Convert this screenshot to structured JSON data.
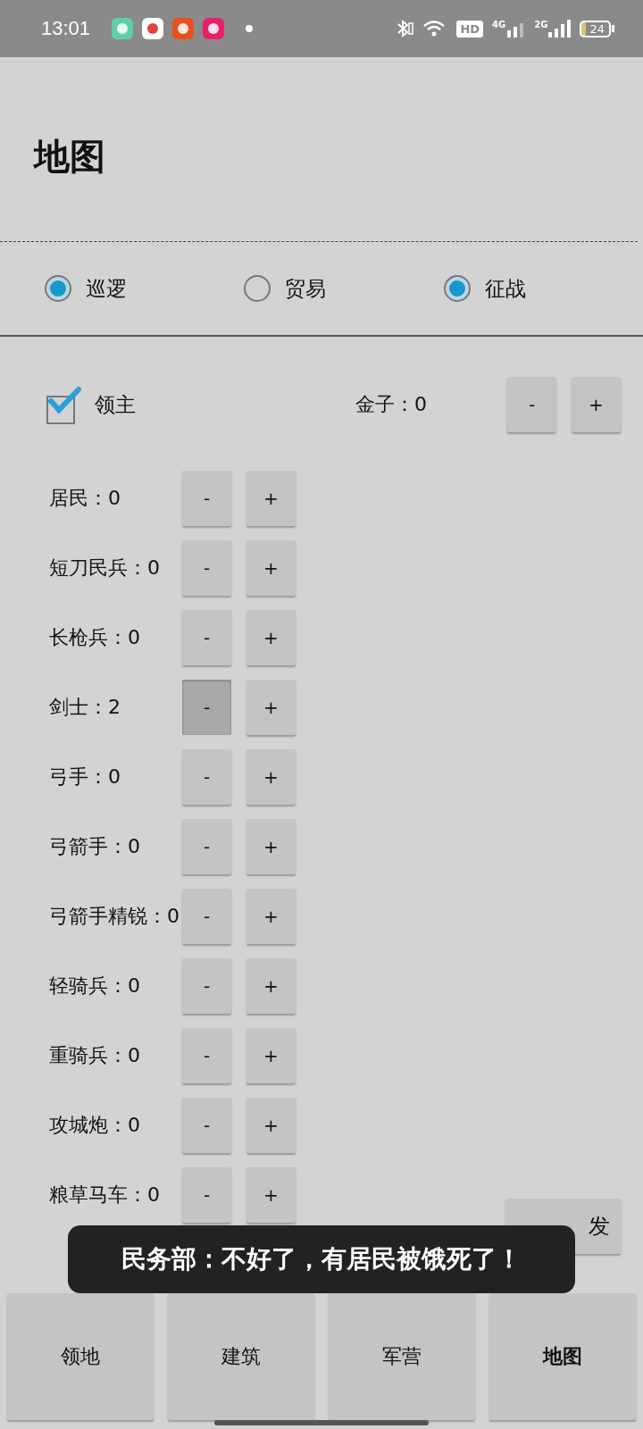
{
  "status_bar": {
    "time": "13:01",
    "hd_label": "HD",
    "network_4g": "4G",
    "network_2g": "2G",
    "battery": "24"
  },
  "title": "地图",
  "modes": [
    {
      "label": "巡逻",
      "checked": true
    },
    {
      "label": "贸易",
      "checked": false
    },
    {
      "label": "征战",
      "checked": true
    }
  ],
  "lord": {
    "label": "领主",
    "checked": true
  },
  "gold": {
    "label": "金子：0",
    "minus": "-",
    "plus": "+"
  },
  "units": [
    {
      "label": "居民：0",
      "minus": "-",
      "plus": "+",
      "minus_pressed": false
    },
    {
      "label": "短刀民兵：0",
      "minus": "-",
      "plus": "+",
      "minus_pressed": false
    },
    {
      "label": "长枪兵：0",
      "minus": "-",
      "plus": "+",
      "minus_pressed": false
    },
    {
      "label": "剑士：2",
      "minus": "-",
      "plus": "+",
      "minus_pressed": true
    },
    {
      "label": "弓手：0",
      "minus": "-",
      "plus": "+",
      "minus_pressed": false
    },
    {
      "label": "弓箭手：0",
      "minus": "-",
      "plus": "+",
      "minus_pressed": false
    },
    {
      "label": "弓箭手精锐：0",
      "minus": "-",
      "plus": "+",
      "minus_pressed": false
    },
    {
      "label": "轻骑兵：0",
      "minus": "-",
      "plus": "+",
      "minus_pressed": false
    },
    {
      "label": "重骑兵：0",
      "minus": "-",
      "plus": "+",
      "minus_pressed": false
    },
    {
      "label": "攻城炮：0",
      "minus": "-",
      "plus": "+",
      "minus_pressed": false
    },
    {
      "label": "粮草马车：0",
      "minus": "-",
      "plus": "+",
      "minus_pressed": false
    }
  ],
  "depart_button": "发",
  "toast": "民务部：不好了，有居民被饿死了！",
  "tabs": [
    {
      "label": "领地",
      "selected": false
    },
    {
      "label": "建筑",
      "selected": false
    },
    {
      "label": "军营",
      "selected": false
    },
    {
      "label": "地图",
      "selected": true
    }
  ]
}
